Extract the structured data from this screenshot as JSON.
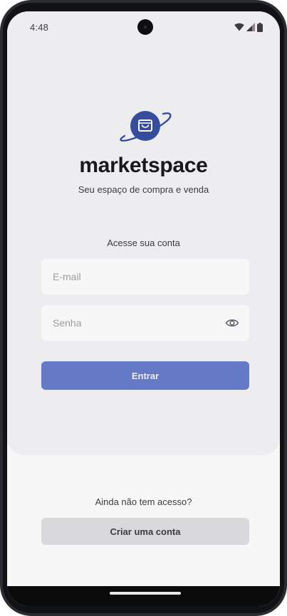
{
  "status_bar": {
    "time": "4:48",
    "icons": [
      "wifi-icon",
      "signal-icon",
      "battery-icon"
    ]
  },
  "brand": {
    "logo_icon": "shopping-bag-planet-icon",
    "name": "marketspace",
    "tagline": "Seu espaço de compra e venda"
  },
  "login": {
    "title": "Acesse sua conta",
    "email_placeholder": "E-mail",
    "password_placeholder": "Senha",
    "password_toggle_icon": "eye-icon",
    "submit_label": "Entrar"
  },
  "signup": {
    "title": "Ainda não tem acesso?",
    "button_label": "Criar uma conta"
  },
  "colors": {
    "primary": "#647AC7",
    "logo": "#364D9D",
    "card_bg": "#EDEDF0",
    "page_bg": "#F7F7F8",
    "secondary_button": "#D9D8DA",
    "text": "#3E3A40",
    "heading": "#1A181B"
  }
}
